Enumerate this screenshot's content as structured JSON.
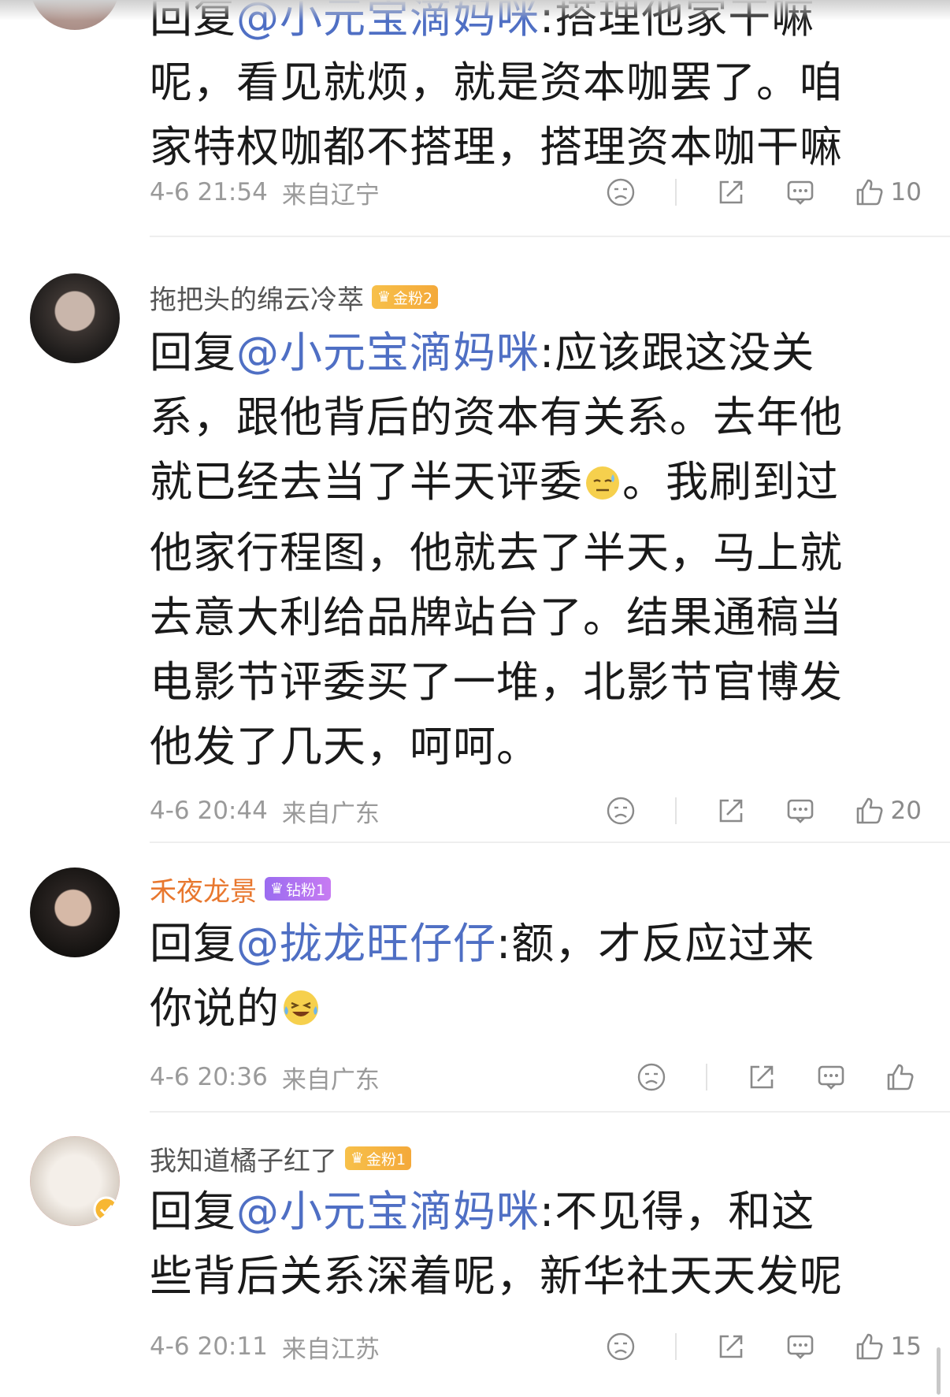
{
  "comments": [
    {
      "prefix": "回复",
      "mention": "@小元宝滴妈咪",
      "line0": ":搭理他家干嘛",
      "line1": "呢，看见就烦，就是资本咖罢了。咱",
      "line2": "家特权咖都不搭理，搭理资本咖干嘛",
      "time": "4-6 21:54",
      "location": "来自辽宁",
      "likes": "10"
    },
    {
      "username": "拖把头的绵云冷萃",
      "badge": "金粉2",
      "prefix": "回复",
      "mention": "@小元宝滴妈咪",
      "line0": ":应该跟这没关",
      "line1": "系，跟他背后的资本有关系。去年他",
      "line2a": "就已经去当了半天评委",
      "line2b": "。我刷到过",
      "line3": "他家行程图，他就去了半天，马上就",
      "line4": "去意大利给品牌站台了。结果通稿当",
      "line5": "电影节评委买了一堆，北影节官博发",
      "line6": "他发了几天，呵呵。",
      "time": "4-6 20:44",
      "location": "来自广东",
      "likes": "20"
    },
    {
      "username": "禾夜龙景",
      "badge": "钻粉1",
      "prefix": "回复",
      "mention": "@拢龙旺仔仔",
      "line0": ":额，才反应过来",
      "line1": "你说的",
      "time": "4-6 20:36",
      "location": "来自广东",
      "likes": ""
    },
    {
      "username": "我知道橘子红了",
      "badge": "金粉1",
      "prefix": "回复",
      "mention": "@小元宝滴妈咪",
      "line0": ":不见得，和这",
      "line1": "些背后关系深着呢，新华社天天发呢",
      "time": "4-6 20:11",
      "location": "来自江苏",
      "likes": "15"
    }
  ],
  "colors": {
    "mention": "#4f6fc4",
    "vip_name": "#e8772e",
    "gold_badge": "#f4a93a",
    "diamond_badge": "#9b6cf0"
  }
}
